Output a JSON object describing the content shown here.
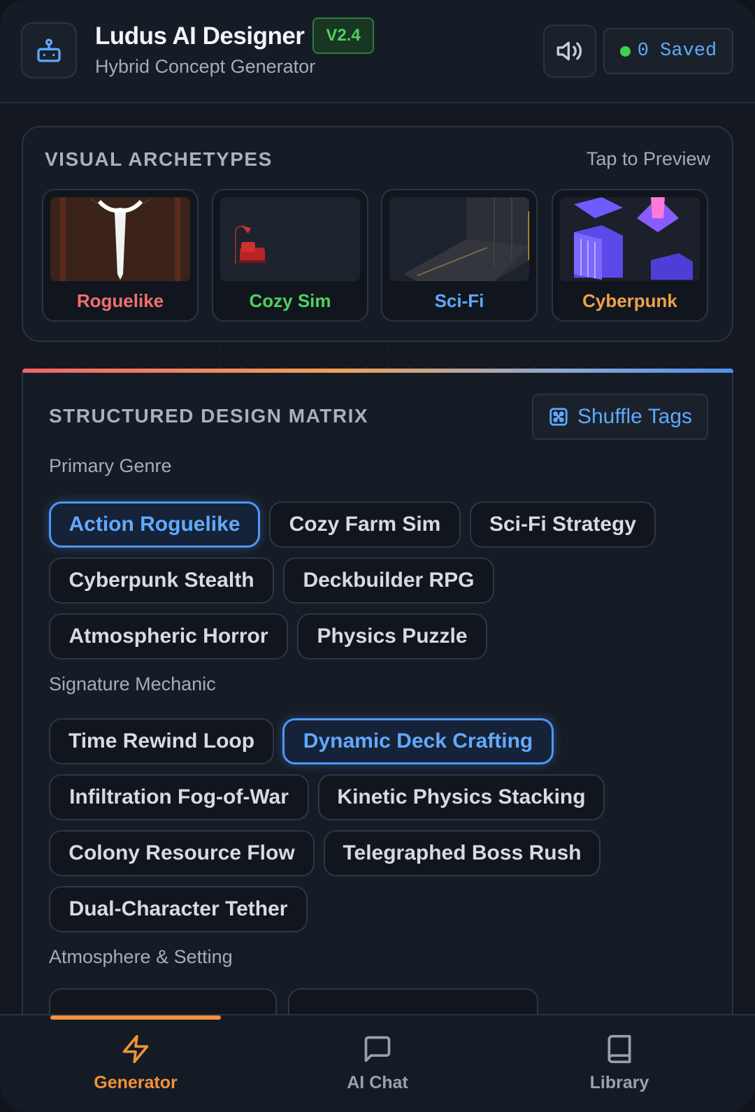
{
  "header": {
    "title": "Ludus AI Designer",
    "version": "V2.4",
    "subtitle": "Hybrid Concept Generator",
    "saved_label": "0 Saved",
    "icons": {
      "logo": "robot-icon",
      "sound": "speaker-icon"
    }
  },
  "archetypes": {
    "heading": "VISUAL ARCHETYPES",
    "hint": "Tap to Preview",
    "cards": [
      {
        "label": "Roguelike",
        "color": "#f07070"
      },
      {
        "label": "Cozy Sim",
        "color": "#4fd160"
      },
      {
        "label": "Sci-Fi",
        "color": "#5fa8ff"
      },
      {
        "label": "Cyberpunk",
        "color": "#f0a04a"
      }
    ]
  },
  "matrix": {
    "heading": "STRUCTURED DESIGN MATRIX",
    "shuffle_label": "Shuffle Tags",
    "groups": [
      {
        "label": "Primary Genre",
        "chips": [
          "Action Roguelike",
          "Cozy Farm Sim",
          "Sci-Fi Strategy",
          "Cyberpunk Stealth",
          "Deckbuilder RPG",
          "Atmospheric Horror",
          "Physics Puzzle"
        ],
        "selected": "Action Roguelike"
      },
      {
        "label": "Signature Mechanic",
        "chips": [
          "Time Rewind Loop",
          "Dynamic Deck Crafting",
          "Infiltration Fog-of-War",
          "Kinetic Physics Stacking",
          "Colony Resource Flow",
          "Telegraphed Boss Rush",
          "Dual-Character Tether"
        ],
        "selected": "Dynamic Deck Crafting"
      },
      {
        "label": "Atmosphere & Setting",
        "chips": [],
        "selected": ""
      }
    ]
  },
  "nav": {
    "items": [
      {
        "label": "Generator",
        "icon": "lightning-icon",
        "active": true
      },
      {
        "label": "AI Chat",
        "icon": "chat-bubble-icon",
        "active": false
      },
      {
        "label": "Library",
        "icon": "book-icon",
        "active": false
      }
    ],
    "active_color": "#f0923a",
    "inactive_color": "#9aa1ab"
  }
}
